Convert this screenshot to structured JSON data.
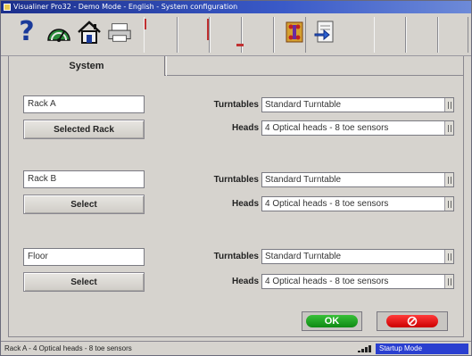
{
  "window": {
    "title": "Visualiner Pro32 - Demo Mode - English - System configuration"
  },
  "toolbar": {
    "icons": [
      "help-icon",
      "speedometer-icon",
      "home-icon",
      "printer-icon",
      "vehicle-specs-icon",
      "procedure-icon"
    ]
  },
  "tabs": [
    {
      "label": "System"
    }
  ],
  "racks": [
    {
      "name": "Rack A",
      "button_label": "Selected Rack",
      "turntables_label": "Turntables",
      "turntables_value": "Standard Turntable",
      "heads_label": "Heads",
      "heads_value": "4 Optical heads - 8 toe sensors"
    },
    {
      "name": "Rack B",
      "button_label": "Select",
      "turntables_label": "Turntables",
      "turntables_value": "Standard Turntable",
      "heads_label": "Heads",
      "heads_value": "4 Optical heads - 8 toe sensors"
    },
    {
      "name": "Floor",
      "button_label": "Select",
      "turntables_label": "Turntables",
      "turntables_value": "Standard Turntable",
      "heads_label": "Heads",
      "heads_value": "4 Optical heads - 8 toe sensors"
    }
  ],
  "actions": {
    "ok_label": "OK",
    "cancel_icon": "cancel-circle-icon"
  },
  "statusbar": {
    "text": "Rack A - 4 Optical heads - 8 toe sensors",
    "mode": "Startup Mode"
  },
  "colors": {
    "ok": "#14a01a",
    "cancel": "#e01010",
    "mode_bg": "#2a3fd0"
  }
}
